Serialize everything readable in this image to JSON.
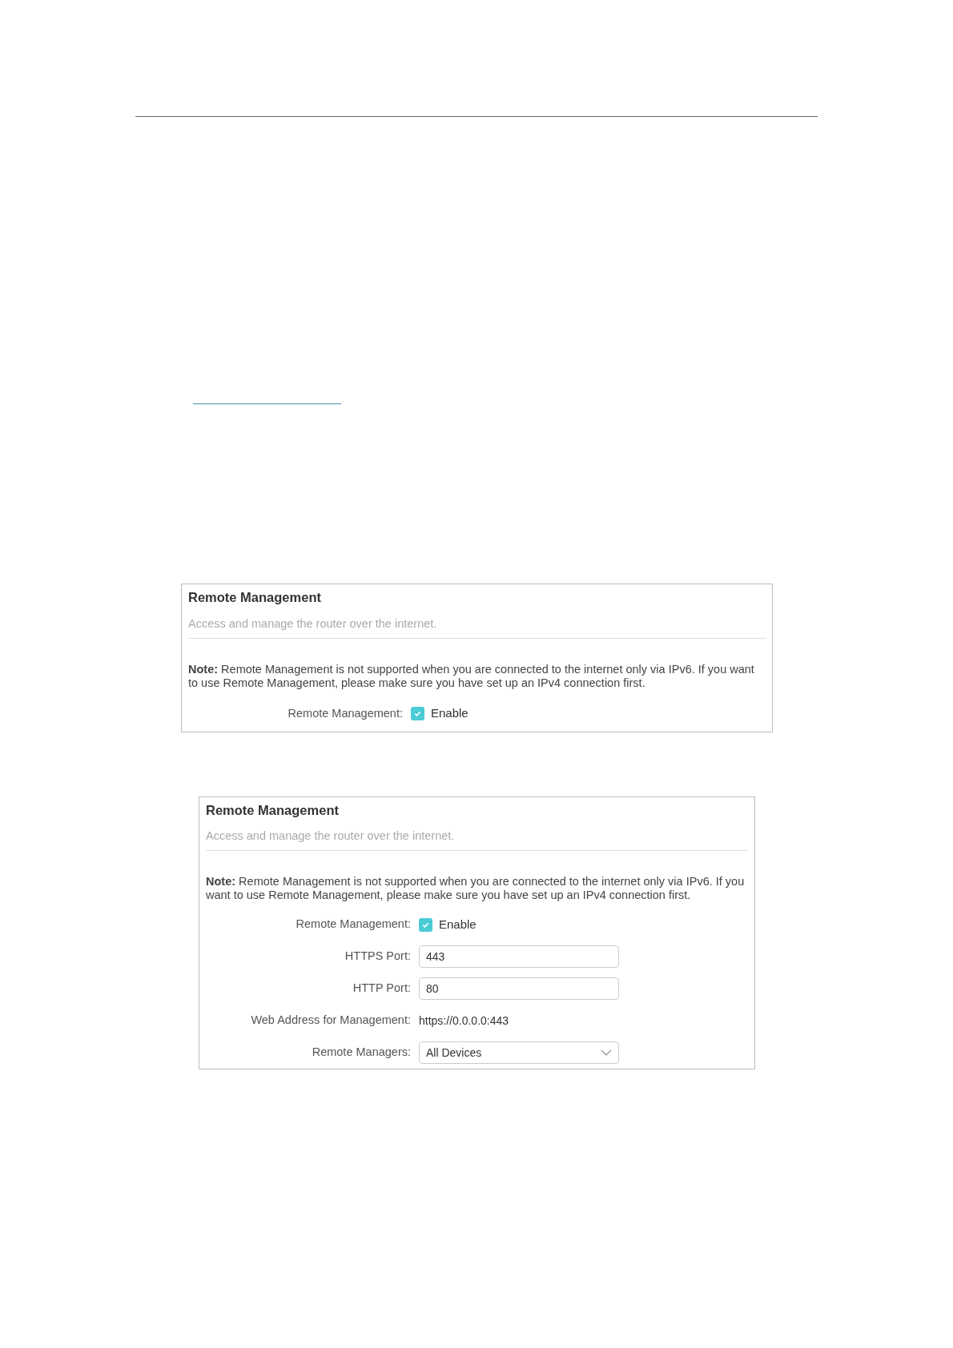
{
  "panels": [
    {
      "title": "Remote Management",
      "subtitle": "Access and manage the router over the internet.",
      "note": "**Note:** Remote Management is not supported when you are connected to the internet only via IPv6. If you want to use Remote Management, please make sure you have set up an IPv4 connection first.",
      "rows": [
        {
          "kind": "checkbox",
          "label": "Remote Management:",
          "text": "Enable",
          "checked": true
        }
      ]
    },
    {
      "title": "Remote Management",
      "subtitle": "Access and manage the router over the internet.",
      "note": "**Note:** Remote Management is not supported when you are connected to the internet only via IPv6. If you want to use Remote Management, please make sure you have set up an IPv4 connection first.",
      "rows": [
        {
          "kind": "checkbox",
          "label": "Remote Management:",
          "text": "Enable",
          "checked": true
        },
        {
          "kind": "input",
          "label": "HTTPS Port:",
          "value": "443"
        },
        {
          "kind": "input",
          "label": "HTTP Port:",
          "value": "80"
        },
        {
          "kind": "static",
          "label": "Web Address for Management:",
          "value": "https://0.0.0.0:443"
        },
        {
          "kind": "select",
          "label": "Remote Managers:",
          "value": "All Devices"
        }
      ]
    }
  ]
}
